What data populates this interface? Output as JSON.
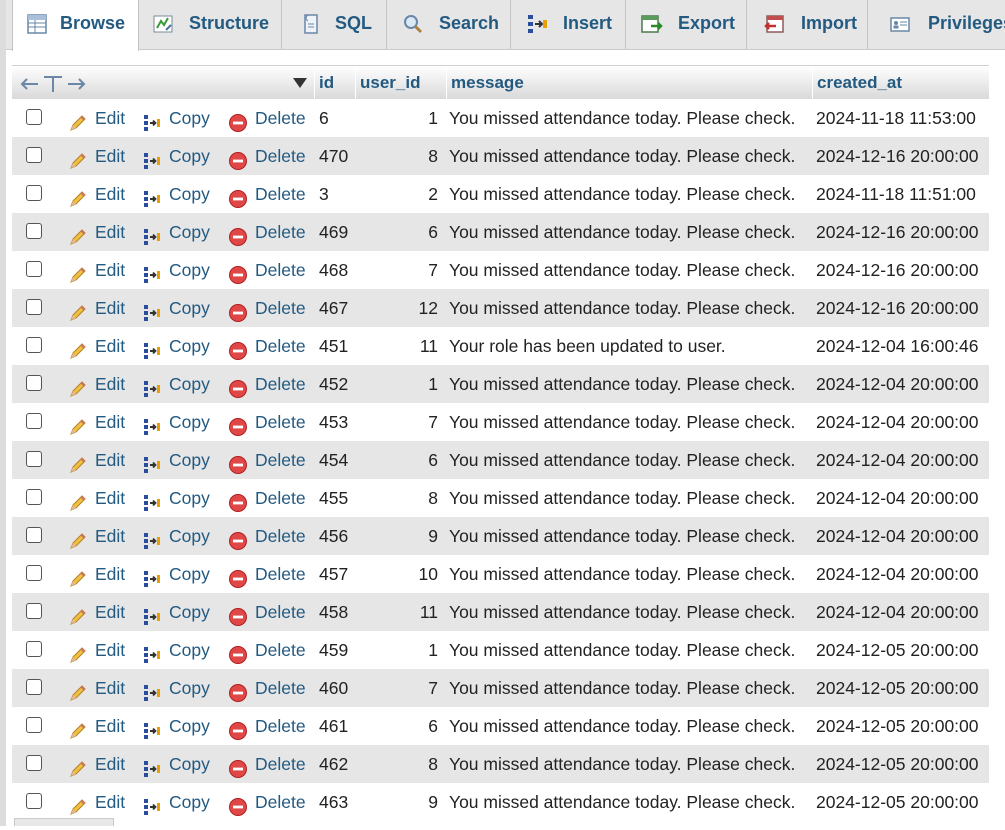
{
  "tabs": [
    {
      "label": "Browse",
      "icon": "browse-icon",
      "active": true
    },
    {
      "label": "Structure",
      "icon": "structure-icon"
    },
    {
      "label": "SQL",
      "icon": "sql-icon"
    },
    {
      "label": "Search",
      "icon": "search-icon"
    },
    {
      "label": "Insert",
      "icon": "insert-icon"
    },
    {
      "label": "Export",
      "icon": "export-icon"
    },
    {
      "label": "Import",
      "icon": "import-icon"
    },
    {
      "label": "Privileges",
      "icon": "privileges-icon"
    }
  ],
  "columns": {
    "id": "id",
    "user_id": "user_id",
    "message": "message",
    "created_at": "created_at"
  },
  "actions": {
    "edit": "Edit",
    "copy": "Copy",
    "delete": "Delete"
  },
  "rows": [
    {
      "id": "6",
      "user_id": "1",
      "message": "You missed attendance today. Please check.",
      "created_at": "2024-11-18 11:53:00"
    },
    {
      "id": "470",
      "user_id": "8",
      "message": "You missed attendance today. Please check.",
      "created_at": "2024-12-16 20:00:00"
    },
    {
      "id": "3",
      "user_id": "2",
      "message": "You missed attendance today. Please check.",
      "created_at": "2024-11-18 11:51:00"
    },
    {
      "id": "469",
      "user_id": "6",
      "message": "You missed attendance today. Please check.",
      "created_at": "2024-12-16 20:00:00"
    },
    {
      "id": "468",
      "user_id": "7",
      "message": "You missed attendance today. Please check.",
      "created_at": "2024-12-16 20:00:00"
    },
    {
      "id": "467",
      "user_id": "12",
      "message": "You missed attendance today. Please check.",
      "created_at": "2024-12-16 20:00:00"
    },
    {
      "id": "451",
      "user_id": "11",
      "message": "Your role has been updated to user.",
      "created_at": "2024-12-04 16:00:46"
    },
    {
      "id": "452",
      "user_id": "1",
      "message": "You missed attendance today. Please check.",
      "created_at": "2024-12-04 20:00:00"
    },
    {
      "id": "453",
      "user_id": "7",
      "message": "You missed attendance today. Please check.",
      "created_at": "2024-12-04 20:00:00"
    },
    {
      "id": "454",
      "user_id": "6",
      "message": "You missed attendance today. Please check.",
      "created_at": "2024-12-04 20:00:00"
    },
    {
      "id": "455",
      "user_id": "8",
      "message": "You missed attendance today. Please check.",
      "created_at": "2024-12-04 20:00:00"
    },
    {
      "id": "456",
      "user_id": "9",
      "message": "You missed attendance today. Please check.",
      "created_at": "2024-12-04 20:00:00"
    },
    {
      "id": "457",
      "user_id": "10",
      "message": "You missed attendance today. Please check.",
      "created_at": "2024-12-04 20:00:00"
    },
    {
      "id": "458",
      "user_id": "11",
      "message": "You missed attendance today. Please check.",
      "created_at": "2024-12-04 20:00:00"
    },
    {
      "id": "459",
      "user_id": "1",
      "message": "You missed attendance today. Please check.",
      "created_at": "2024-12-05 20:00:00"
    },
    {
      "id": "460",
      "user_id": "7",
      "message": "You missed attendance today. Please check.",
      "created_at": "2024-12-05 20:00:00"
    },
    {
      "id": "461",
      "user_id": "6",
      "message": "You missed attendance today. Please check.",
      "created_at": "2024-12-05 20:00:00"
    },
    {
      "id": "462",
      "user_id": "8",
      "message": "You missed attendance today. Please check.",
      "created_at": "2024-12-05 20:00:00"
    },
    {
      "id": "463",
      "user_id": "9",
      "message": "You missed attendance today. Please check.",
      "created_at": "2024-12-05 20:00:00"
    }
  ]
}
